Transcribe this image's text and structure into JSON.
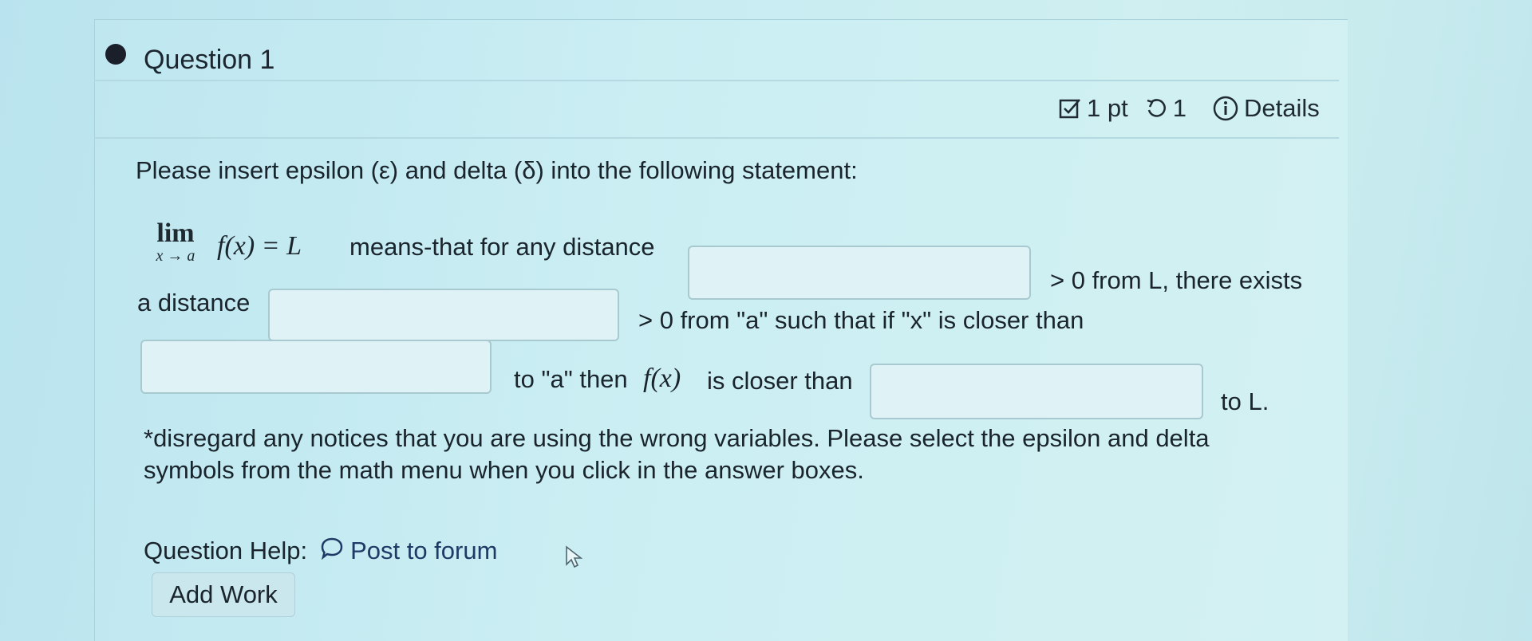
{
  "question": {
    "title": "Question 1",
    "points": "1 pt",
    "attempts": "1",
    "details_label": "Details"
  },
  "prompt": {
    "intro": "Please insert epsilon (ε) and delta (δ) into the following statement:",
    "lim_label": "lim",
    "lim_sub": "x → a",
    "expr": "f(x) = L",
    "seg_means": "means-that for any distance",
    "seg_gt0_L": "> 0 from L, there exists",
    "seg_a_distance": "a distance",
    "seg_gt0_a": "> 0 from \"a\" such that if \"x\" is closer than",
    "seg_to_a_then": "to \"a\" then",
    "seg_fx": "f(x)",
    "seg_is_closer": "is closer than",
    "seg_to_L": "to L."
  },
  "answers": {
    "box1": "",
    "box2": "",
    "box3": "",
    "box4": ""
  },
  "note": "*disregard any notices that you are using the wrong variables. Please select the epsilon and delta symbols from the math menu when you click in the answer boxes.",
  "help": {
    "label": "Question Help:",
    "forum_link": "Post to forum",
    "add_work": "Add Work"
  },
  "icons": {
    "points": "checkbox-icon",
    "attempts": "retry-icon",
    "details": "info-icon",
    "forum": "chat-bubble-icon",
    "cursor": "mouse-pointer-icon"
  }
}
